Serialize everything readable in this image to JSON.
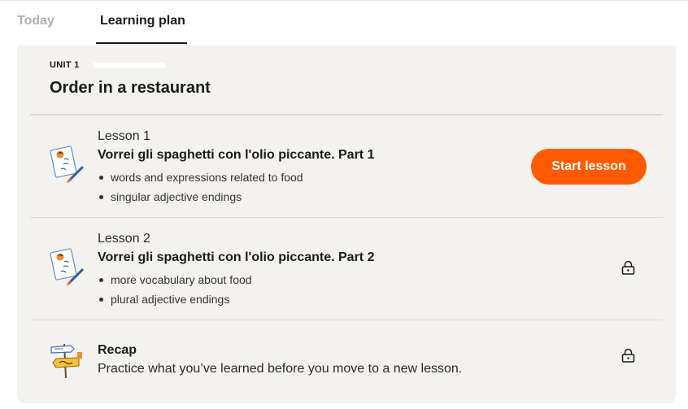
{
  "tabs": [
    {
      "label": "Today",
      "active": false
    },
    {
      "label": "Learning plan",
      "active": true
    }
  ],
  "unit": {
    "label": "UNIT 1",
    "title": "Order in a restaurant"
  },
  "lessons": [
    {
      "number": "Lesson 1",
      "title": "Vorrei gli spaghetti con l'olio piccante. Part 1",
      "bullets": [
        "words and expressions related to food",
        "singular adjective endings"
      ],
      "action": "Start lesson",
      "locked": false,
      "icon": "notepad-pencil-icon"
    },
    {
      "number": "Lesson 2",
      "title": "Vorrei gli spaghetti con l'olio piccante. Part 2",
      "bullets": [
        "more vocabulary about food",
        "plural adjective endings"
      ],
      "locked": true,
      "icon": "notepad-pencil-icon"
    }
  ],
  "recap": {
    "title": "Recap",
    "description": "Practice what you’ve learned before you move to a new lesson.",
    "locked": true,
    "icon": "signpost-icon"
  },
  "colors": {
    "accent": "#ff5a00",
    "panel": "#f4f2ee",
    "inactive_tab": "#b3b0ab"
  }
}
